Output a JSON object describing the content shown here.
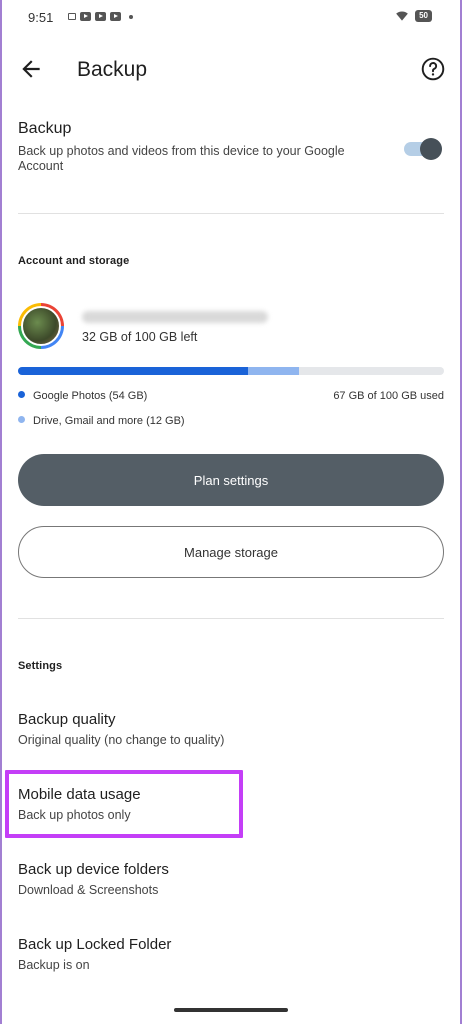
{
  "status_bar": {
    "time": "9:51",
    "battery": "50"
  },
  "app_bar": {
    "title": "Backup"
  },
  "backup": {
    "title": "Backup",
    "description": "Back up photos and videos from this device to your Google Account",
    "enabled": true
  },
  "account_storage": {
    "section_label": "Account and storage",
    "storage_left": "32 GB of 100 GB left",
    "photos_fraction": 0.54,
    "other_fraction": 0.12,
    "legend_photos": "Google Photos (54 GB)",
    "legend_other": "Drive, Gmail and more (12 GB)",
    "used_summary": "67 GB of 100 GB used",
    "colors": {
      "photos": "#1a63d8",
      "other": "#8fb5ef"
    },
    "plan_button": "Plan settings",
    "manage_button": "Manage storage"
  },
  "settings": {
    "section_label": "Settings",
    "items": [
      {
        "title": "Backup quality",
        "subtitle": "Original quality (no change to quality)"
      },
      {
        "title": "Mobile data usage",
        "subtitle": "Back up photos only"
      },
      {
        "title": "Back up device folders",
        "subtitle": "Download & Screenshots"
      },
      {
        "title": "Back up Locked Folder",
        "subtitle": "Backup is on"
      }
    ]
  },
  "highlight_color": "#c43ef7"
}
